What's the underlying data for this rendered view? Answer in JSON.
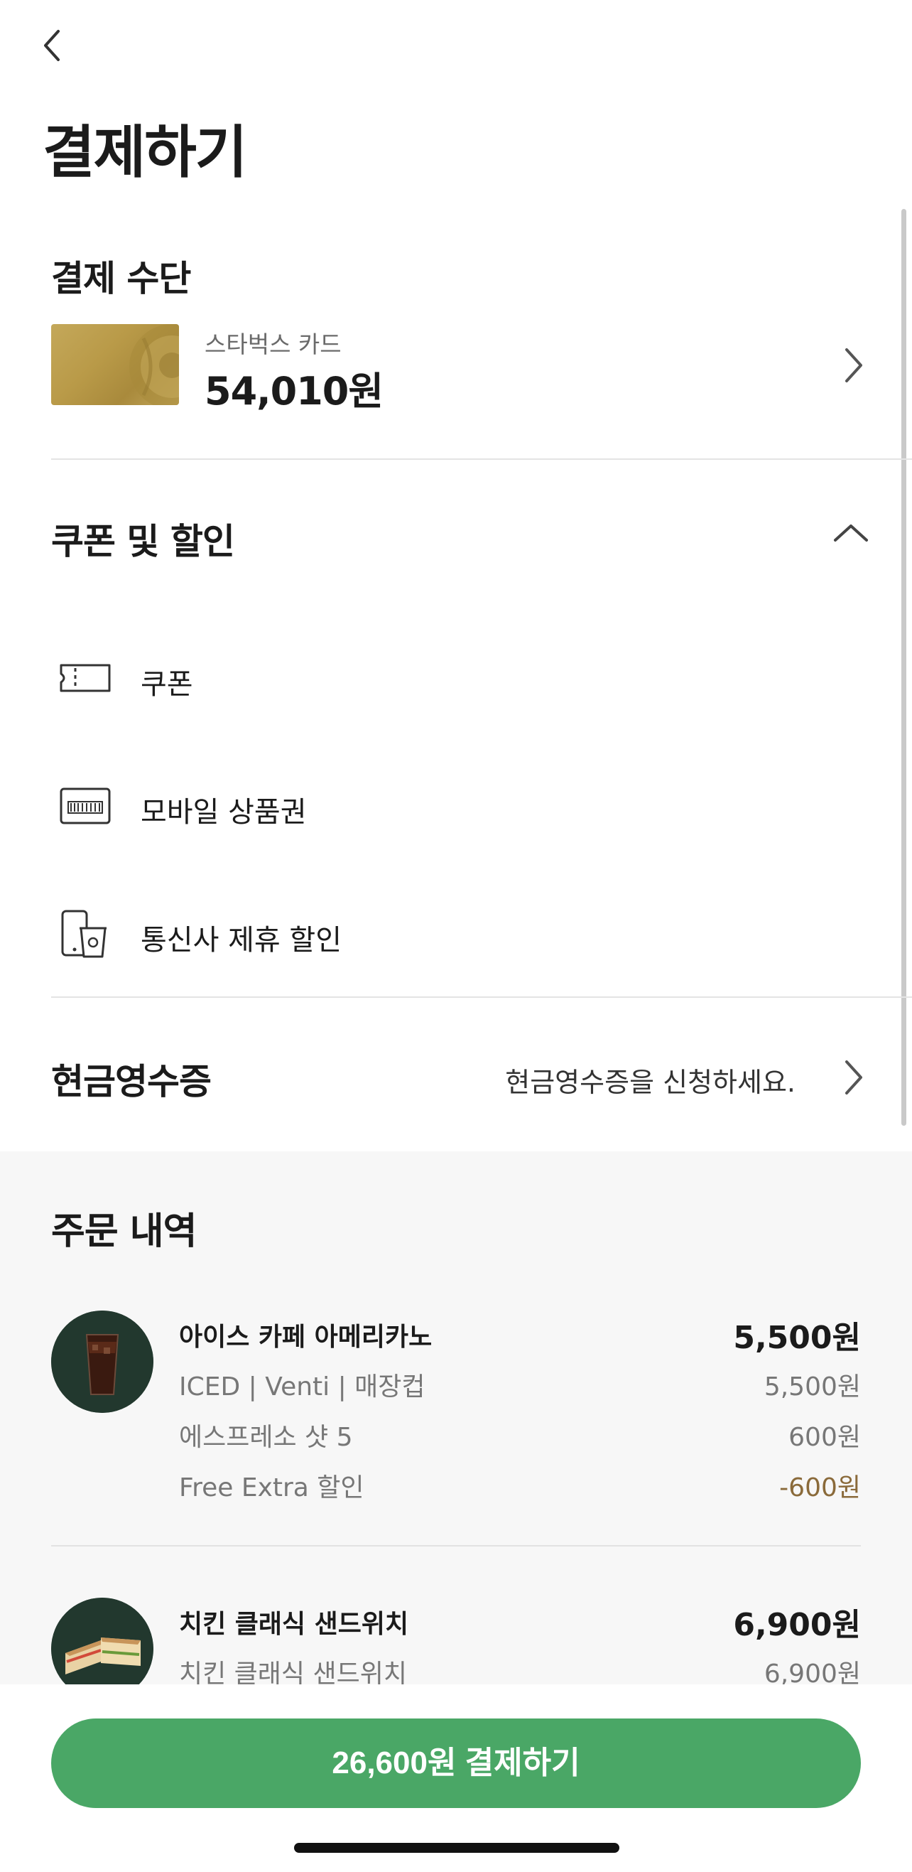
{
  "header": {
    "back_icon": "chevron-left-icon",
    "title": "결제하기"
  },
  "payment_method": {
    "section_title": "결제 수단",
    "card_name": "스타벅스 카드",
    "card_balance": "54,010원",
    "chevron_icon": "chevron-right-icon"
  },
  "discounts": {
    "section_title": "쿠폰 및 할인",
    "toggle_icon": "chevron-up-icon",
    "items": [
      {
        "icon": "coupon-icon",
        "label": "쿠폰"
      },
      {
        "icon": "mobile-voucher-icon",
        "label": "모바일 상품권"
      },
      {
        "icon": "carrier-discount-icon",
        "label": "통신사 제휴 할인"
      }
    ]
  },
  "cash_receipt": {
    "title": "현금영수증",
    "hint": "현금영수증을 신청하세요."
  },
  "order": {
    "section_title": "주문 내역",
    "items": [
      {
        "name": "아이스 카페 아메리카노",
        "price": "5,500원",
        "lines": [
          {
            "label": "ICED | Venti | 매장컵",
            "price": "5,500원"
          },
          {
            "label": "에스프레소 샷 5",
            "price": "600원"
          },
          {
            "label": "Free Extra 할인",
            "price": "-600원"
          }
        ]
      },
      {
        "name": "치킨 클래식 샌드위치",
        "price": "6,900원",
        "lines": [
          {
            "label": "치킨 클래식 샌드위치",
            "price": "6,900원"
          }
        ]
      }
    ]
  },
  "pay_button": {
    "label": "26,600원 결제하기"
  },
  "colors": {
    "accent_green": "#4aa766",
    "discount_brown": "#8a6a3a",
    "card_gold": "#b99a48"
  }
}
